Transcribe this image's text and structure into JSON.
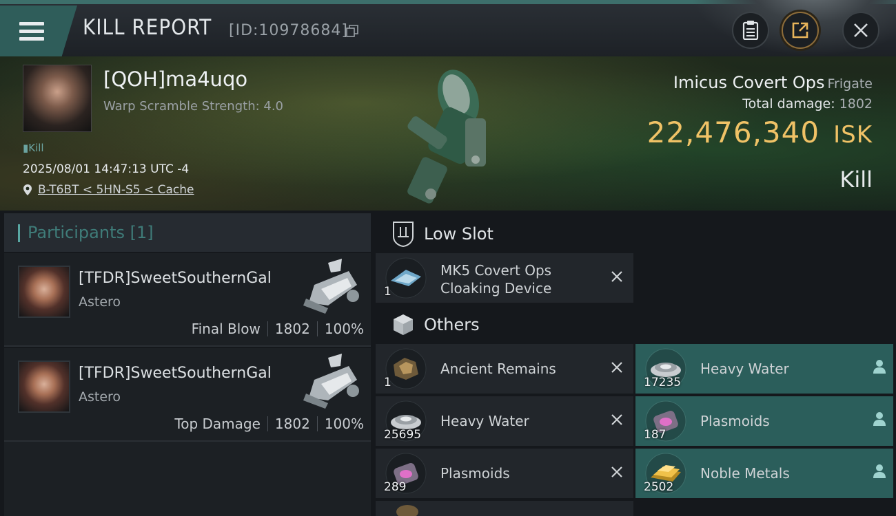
{
  "header": {
    "title": "KILL REPORT",
    "kill_id": "[ID:10978684]"
  },
  "victim": {
    "name": "[QOH]ma4uqo",
    "warp_scramble": "Warp Scramble Strength: 4.0",
    "tag": "Kill",
    "datetime": "2025/08/01 14:47:13 UTC -4",
    "location": "B-T6BT < 5HN-S5 < Cache"
  },
  "ship": {
    "name": "Imicus Covert Ops",
    "class": "Frigate",
    "total_damage_label": "Total damage:",
    "total_damage": "1802",
    "isk_value": "22,476,340",
    "isk_unit": "ISK",
    "result": "Kill"
  },
  "participants": {
    "header": "Participants [1]",
    "rows": [
      {
        "name": "[TFDR]SweetSouthernGal",
        "ship": "Astero",
        "role": "Final Blow",
        "damage": "1802",
        "percent": "100%"
      },
      {
        "name": "[TFDR]SweetSouthernGal",
        "ship": "Astero",
        "role": "Top Damage",
        "damage": "1802",
        "percent": "100%"
      }
    ]
  },
  "sections": {
    "low_slot": "Low Slot",
    "others": "Others"
  },
  "items": {
    "low_slot": [
      {
        "name": "MK5 Covert Ops Cloaking Device",
        "qty": "1"
      }
    ],
    "others": [
      {
        "name": "Ancient Remains",
        "qty": "1",
        "dropped": false
      },
      {
        "name": "Heavy Water",
        "qty": "17235",
        "dropped": true
      },
      {
        "name": "Heavy Water",
        "qty": "25695",
        "dropped": false
      },
      {
        "name": "Plasmoids",
        "qty": "187",
        "dropped": true
      },
      {
        "name": "Plasmoids",
        "qty": "289",
        "dropped": false
      },
      {
        "name": "Noble Metals",
        "qty": "2502",
        "dropped": true
      }
    ]
  },
  "colors": {
    "accent_teal": "#2b5e5b",
    "isk_gold": "#f0c266"
  }
}
